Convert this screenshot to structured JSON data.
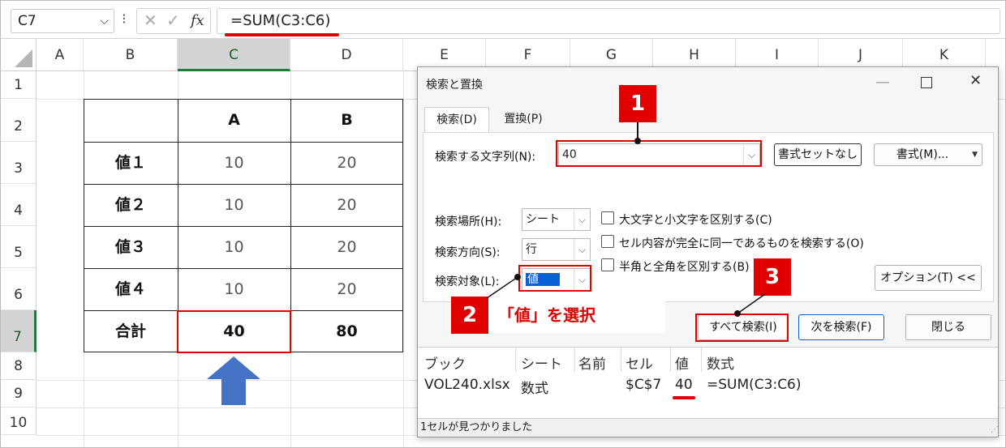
{
  "formula_bar": {
    "name_box": "C7",
    "fx": "fx",
    "cancel": "✕",
    "enter": "✓",
    "formula": "=SUM(C3:C6)"
  },
  "columns": [
    "A",
    "B",
    "C",
    "D",
    "E",
    "F",
    "G",
    "H",
    "I",
    "J",
    "K"
  ],
  "rows": [
    "1",
    "2",
    "3",
    "4",
    "5",
    "6",
    "7",
    "8",
    "9",
    "10"
  ],
  "table": {
    "header": [
      "",
      "A",
      "B"
    ],
    "rows": [
      [
        "値１",
        "10",
        "20"
      ],
      [
        "値２",
        "10",
        "20"
      ],
      [
        "値３",
        "10",
        "20"
      ],
      [
        "値４",
        "10",
        "20"
      ],
      [
        "合計",
        "40",
        "80"
      ]
    ]
  },
  "dialog": {
    "title": "検索と置換",
    "tabs": [
      "検索(D)",
      "置換(P)"
    ],
    "find_label": "検索する文字列(N):",
    "find_value": "40",
    "no_format_btn": "書式セットなし",
    "format_btn": "書式(M)...",
    "within_label": "検索場所(H):",
    "within_value": "シート",
    "search_label": "検索方向(S):",
    "search_value": "行",
    "lookin_label": "検索対象(L):",
    "lookin_value": "値",
    "opt_case": "大文字と小文字を区別する(C)",
    "opt_entire": "セル内容が完全に同一であるものを検索する(O)",
    "opt_width": "半角と全角を区別する(B)",
    "options_btn": "オプション(T) <<",
    "find_all_btn": "すべて検索(I)",
    "find_next_btn": "次を検索(F)",
    "close_btn": "閉じる",
    "results_headers": [
      "ブック",
      "シート",
      "名前",
      "セル",
      "値",
      "数式"
    ],
    "results_row": [
      "VOL240.xlsx",
      "数式",
      "",
      "$C$7",
      "40",
      "=SUM(C3:C6)"
    ],
    "status": "1セルが見つかりました"
  },
  "annotations": {
    "step1": "1",
    "step2": "2",
    "step3": "3",
    "step2_text": "「値」を選択"
  },
  "colors": {
    "accent_red": "#e00000",
    "arrow_blue": "#4472c4",
    "excel_green": "#1f5c2c"
  }
}
